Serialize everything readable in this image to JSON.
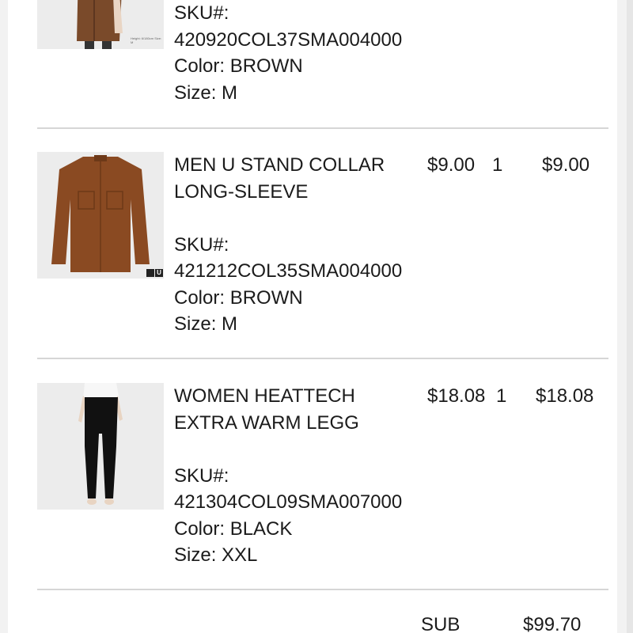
{
  "items": [
    {
      "name": "",
      "price": "",
      "qty": "",
      "total": "",
      "sku_label": "SKU#:",
      "sku": "420920COL37SMA004000",
      "color": "Color: BROWN",
      "size": "Size: M",
      "image_icon": "brown-coat-model-photo",
      "image_caption": "Height: 6/180cm  Size: M"
    },
    {
      "name_line1": "MEN U STAND COLLAR",
      "name_line2": "LONG-SLEEVE",
      "price": "$9.00",
      "qty": "1",
      "total": "$9.00",
      "sku_label": "SKU#:",
      "sku": "421212COL35SMA004000",
      "color": "Color: BROWN",
      "size": "Size: M",
      "image_icon": "brown-shirt-photo",
      "badge": "U"
    },
    {
      "name_line1": "WOMEN HEATTECH",
      "name_line2": "EXTRA WARM LEGG",
      "price": "$18.08",
      "qty": "1",
      "total": "$18.08",
      "sku_label": "SKU#:",
      "sku": "421304COL09SMA007000",
      "color": "Color: BLACK",
      "size": "Size: XXL",
      "image_icon": "black-leggings-model-photo"
    }
  ],
  "summary": {
    "label": "SUB",
    "value": "$99.70"
  },
  "colors": {
    "text": "#1b1b1b",
    "divider": "#d6d6d6",
    "shirt_brown": "#8a4a22",
    "coat_brown": "#7a4a2a",
    "leggings_black": "#111111"
  }
}
